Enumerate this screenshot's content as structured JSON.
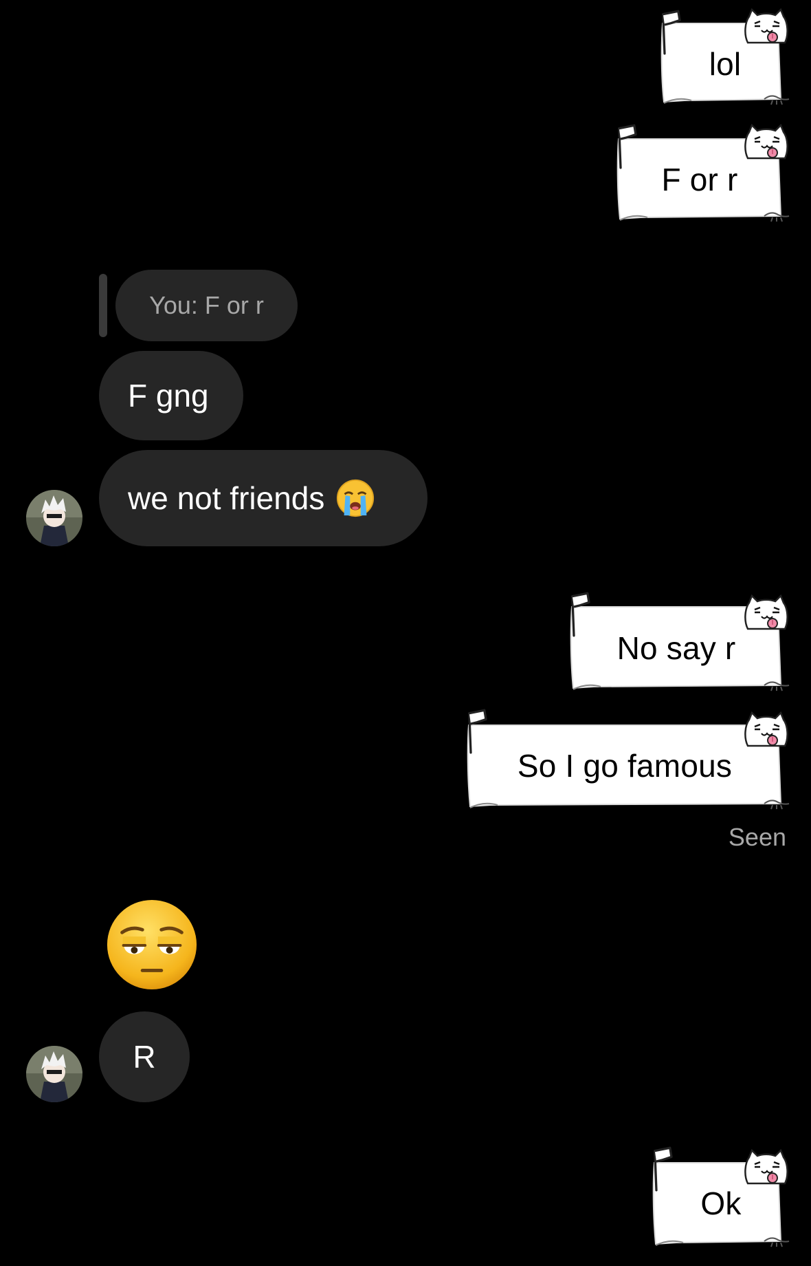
{
  "messages": {
    "out_1": {
      "text": "lol"
    },
    "out_2": {
      "text": "F or r"
    },
    "reply_preview": {
      "text": "You: F or r"
    },
    "in_1": {
      "text": "F gng"
    },
    "in_2": {
      "text": "we not friends",
      "emoji": "loudly-crying-face"
    },
    "out_3": {
      "text": "No say r"
    },
    "out_4": {
      "text": "So I go famous"
    },
    "seen_label": "Seen",
    "in_emoji": {
      "emoji": "pensive-face"
    },
    "in_3": {
      "text": "R"
    },
    "out_5": {
      "text": "Ok"
    }
  },
  "colors": {
    "background": "#000000",
    "incoming_bubble": "#262626",
    "outgoing_bubble": "#ffffff",
    "secondary_text": "#a8a8a8"
  }
}
